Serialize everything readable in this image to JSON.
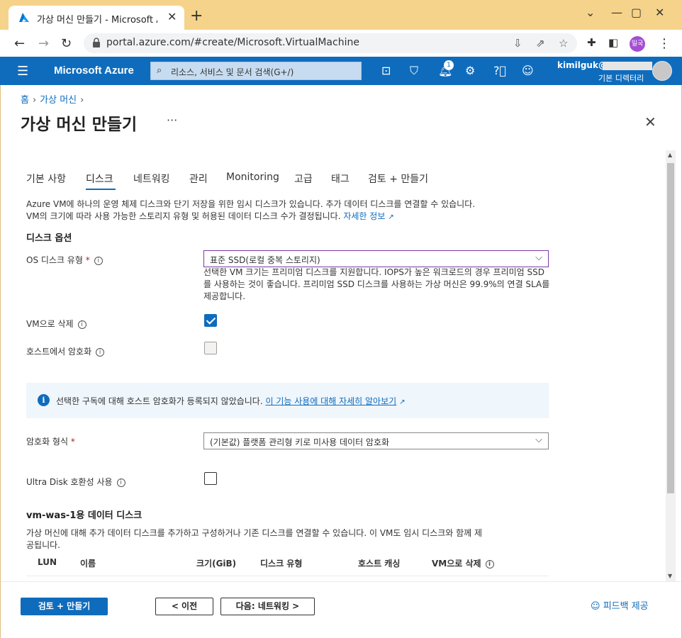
{
  "browser": {
    "tab_title": "가상 머신 만들기 - Microsoft Azure",
    "tab_close": "✕",
    "new_tab": "+",
    "url": "portal.azure.com/#create/Microsoft.VirtualMachine",
    "profile_label": "일국"
  },
  "azure": {
    "brand": "Microsoft Azure",
    "search_placeholder": "리소스, 서비스 및 문서 검색(G+/)",
    "notification_count": "1",
    "user_name": "kimilguk@",
    "user_directory": "기본 디렉터리"
  },
  "page": {
    "breadcrumb": [
      "홈",
      "가상 머신"
    ],
    "title": "가상 머신 만들기",
    "more": "···"
  },
  "tabs": [
    "기본 사항",
    "디스크",
    "네트워킹",
    "관리",
    "Monitoring",
    "고급",
    "태그",
    "검토 + 만들기"
  ],
  "intro": {
    "line1": "Azure VM에 하나의 운영 체제 디스크와 단기 저장을 위한 임시 디스크가 있습니다. 추가 데이터 디스크를 연결할 수 있습니다.",
    "line2": "VM의 크기에 따라 사용 가능한 스토리지 유형 및 허용된 데이터 디스크 수가 결정됩니다.",
    "link": "자세한 정보"
  },
  "disk_options": {
    "heading": "디스크 옵션",
    "os_disk_label": "OS 디스크 유형",
    "os_disk_value": "표준 SSD(로컬 중복 스토리지)",
    "os_disk_help": "선택한 VM 크기는 프리미엄 디스크를 지원합니다. IOPS가 높은 워크로드의 경우 프리미엄 SSD를 사용하는 것이 좋습니다. 프리미엄 SSD 디스크를 사용하는 가상 머신은 99.9%의 연결 SLA를 제공합니다.",
    "delete_with_vm_label": "VM으로 삭제",
    "delete_with_vm_checked": true,
    "host_encryption_label": "호스트에서 암호화",
    "host_encryption_checked": false,
    "info_text": "선택한 구독에 대해 호스트 암호화가 등록되지 않았습니다.",
    "info_link": "이 기능 사용에 대해 자세히 알아보기",
    "encryption_type_label": "암호화 형식",
    "encryption_type_value": "(기본값) 플랫폼 관리형 키로 미사용 데이터 암호화",
    "ultra_disk_label": "Ultra Disk 호환성 사용",
    "ultra_disk_checked": false
  },
  "data_disks": {
    "heading": "vm-was-1용 데이터 디스크",
    "desc_line1": "가상 머신에 대해 추가 데이터 디스크를 추가하고 구성하거나 기존 디스크를 연결할 수 있습니다. 이 VM도 임시 디스크와 함께 제",
    "desc_line2": "공됩니다.",
    "columns": [
      "LUN",
      "이름",
      "크기(GiB)",
      "디스크 유형",
      "호스트 캐싱",
      "VM으로 삭제"
    ]
  },
  "footer": {
    "review_create": "검토 + 만들기",
    "previous": "< 이전",
    "next": "다음: 네트워킹 >",
    "feedback": "피드백 제공"
  },
  "colors": {
    "azure_blue": "#0f6cbd",
    "browser_frame": "#f6d38a"
  }
}
